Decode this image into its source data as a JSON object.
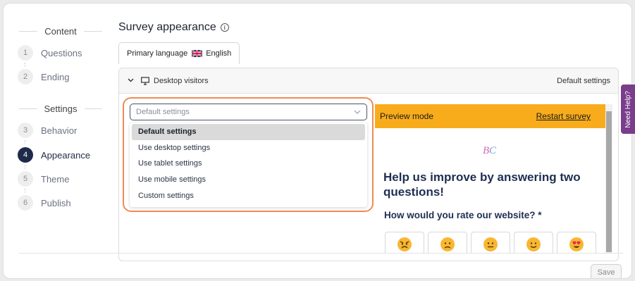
{
  "sidebar": {
    "content_title": "Content",
    "settings_title": "Settings",
    "steps": [
      {
        "num": "1",
        "label": "Questions"
      },
      {
        "num": "2",
        "label": "Ending"
      },
      {
        "num": "3",
        "label": "Behavior"
      },
      {
        "num": "4",
        "label": "Appearance"
      },
      {
        "num": "5",
        "label": "Theme"
      },
      {
        "num": "6",
        "label": "Publish"
      }
    ],
    "active_step": "4"
  },
  "header": {
    "title": "Survey appearance",
    "info_icon": "info-icon"
  },
  "language_tab": {
    "label": "Primary language",
    "language": "English",
    "flag_icon": "uk-flag-icon"
  },
  "panel": {
    "device_label": "Desktop visitors",
    "settings_label": "Default settings"
  },
  "dropdown": {
    "placeholder": "Default settings",
    "options": [
      "Default settings",
      "Use desktop settings",
      "Use tablet settings",
      "Use mobile settings",
      "Custom settings"
    ],
    "selected": "Default settings"
  },
  "preview": {
    "mode_label": "Preview mode",
    "restart_label": "Restart survey",
    "question1": "Help us improve by answering two questions!",
    "question2": "How would you rate our website? *",
    "faces": [
      "angry-face-icon",
      "sad-face-icon",
      "neutral-face-icon",
      "smiling-face-icon",
      "heart-eyes-face-icon"
    ],
    "bar_color": "#f8ac1c"
  },
  "footer": {
    "save_label": "Save"
  },
  "help_tab": {
    "label": "Need Help?"
  },
  "colors": {
    "accent_orange": "#f08a54",
    "active_step": "#1e2a4a",
    "help_tab": "#7a3d8c"
  }
}
